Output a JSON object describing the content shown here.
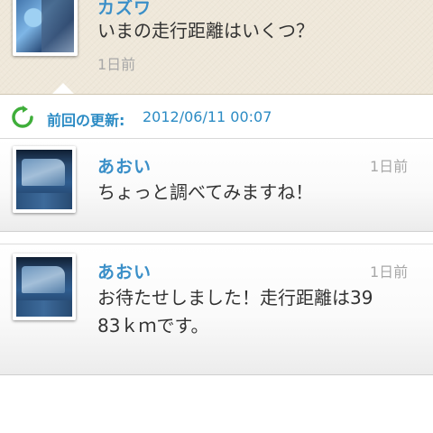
{
  "original_post": {
    "author": "カズワ",
    "message": "いまの走行距離はいくつ？",
    "time": "1日前"
  },
  "update_bar": {
    "label": "前回の更新:",
    "timestamp": "2012/06/11 00:07",
    "icon": "refresh-icon",
    "accent_color": "#2b8bc4"
  },
  "replies": [
    {
      "author": "あおい",
      "time": "1日前",
      "message_lines": [
        "ちょっと調べてみますね！"
      ]
    },
    {
      "author": "あおい",
      "time": "1日前",
      "message_lines": [
        "お待たせしました！走行距離は39",
        "83ｋｍです。"
      ]
    }
  ],
  "colors": {
    "name": "#3a8fc8",
    "text": "#333333",
    "time": "#a8a8a8",
    "paper": "#efe8da"
  }
}
